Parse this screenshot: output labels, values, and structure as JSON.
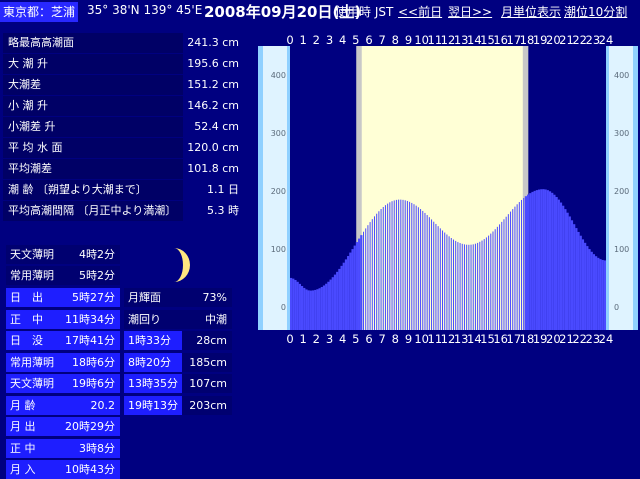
{
  "header": {
    "location": "東京都：芝浦",
    "coords": "35° 38'N 139° 45'E",
    "date": "2008年09月20日(土)",
    "timezone": "使用時 JST",
    "prev_link": "<<前日",
    "next_link": "翌日>>",
    "month_link": "月単位表示",
    "interval_link": "潮位10分割"
  },
  "tide_levels": [
    {
      "label": "略最高高潮面",
      "value": "241.3 cm"
    },
    {
      "label": "大 潮 升",
      "value": "195.6 cm"
    },
    {
      "label": "大潮差",
      "value": "151.2 cm"
    },
    {
      "label": "小 潮 升",
      "value": "146.2 cm"
    },
    {
      "label": "小潮差 升",
      "value": "52.4 cm"
    },
    {
      "label": "平 均 水 面",
      "value": "120.0 cm"
    },
    {
      "label": "平均潮差",
      "value": "101.8 cm"
    },
    {
      "label": "潮 齢 〔朔望より大潮まで〕",
      "value": "1.1 日"
    },
    {
      "label": "平均高潮間隔 〔月正中より満潮〕",
      "value": "5.3 時"
    }
  ],
  "sun_moon": [
    {
      "label": "天文薄明",
      "value": "4時2分"
    },
    {
      "label": "常用薄明",
      "value": "5時2分"
    },
    {
      "label": "日　出",
      "value": "5時27分"
    },
    {
      "label": "正　中",
      "value": "11時34分"
    },
    {
      "label": "日　没",
      "value": "17時41分"
    },
    {
      "label": "常用薄明",
      "value": "18時6分"
    },
    {
      "label": "天文薄明",
      "value": "19時6分"
    },
    {
      "label": "月 齢",
      "value": "20.2"
    },
    {
      "label": "月 出",
      "value": "20時29分"
    },
    {
      "label": "正 中",
      "value": "3時8分"
    },
    {
      "label": "月 入",
      "value": "10時43分"
    }
  ],
  "moon_info": [
    {
      "label": "月輝面",
      "value": "73%"
    },
    {
      "label": "潮回り",
      "value": "中潮"
    }
  ],
  "tides": [
    {
      "time": "1時33分",
      "height": "28cm"
    },
    {
      "time": "8時20分",
      "height": "185cm"
    },
    {
      "time": "13時35分",
      "height": "107cm"
    },
    {
      "time": "19時13分",
      "height": "203cm"
    }
  ],
  "colors": {
    "background": "#000080",
    "bars": "#4a4aff",
    "daylight": "#ffffd6",
    "twilight": "#c8c8c8",
    "scale": "#8fd0ff",
    "moon": "#ffe680"
  },
  "icons": {
    "moon": "gibbous-moon-icon"
  },
  "chart_data": {
    "type": "bar",
    "ylim": [
      -40,
      450
    ],
    "xlim": [
      0,
      24
    ],
    "y_ticks": [
      0,
      100,
      200,
      300,
      400
    ],
    "x_ticks": [
      "0",
      "1",
      "2",
      "3",
      "4",
      "5",
      "6",
      "7",
      "8",
      "9",
      "10",
      "11",
      "12",
      "13",
      "14",
      "15",
      "16",
      "17",
      "18",
      "19",
      "20",
      "21",
      "22",
      "23",
      "24"
    ],
    "daylight": [
      5.45,
      17.68
    ],
    "twilight": [
      5.03,
      18.1
    ],
    "extremes": [
      {
        "time": 1.55,
        "height": 28
      },
      {
        "time": 8.33,
        "height": 185
      },
      {
        "time": 13.58,
        "height": 107
      },
      {
        "time": 19.22,
        "height": 203
      }
    ],
    "start_height": 50,
    "end_height": 80
  }
}
